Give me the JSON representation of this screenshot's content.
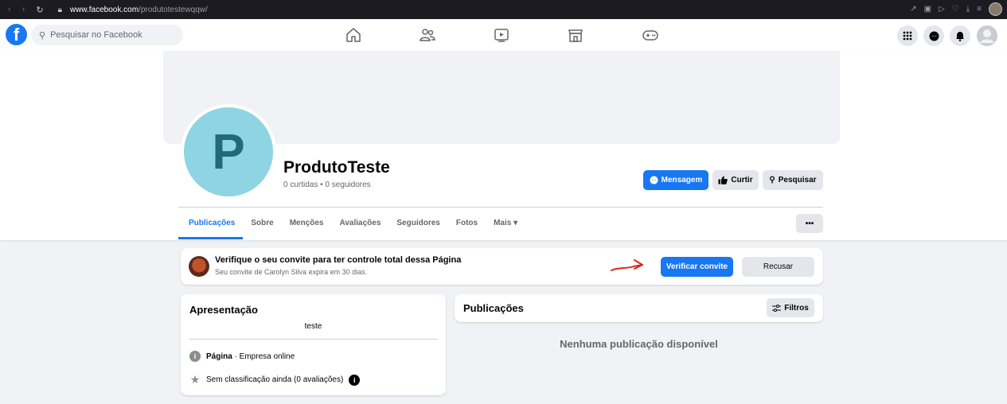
{
  "browser": {
    "url_domain": "www.facebook.com",
    "url_path": "/produtotestewqqw/"
  },
  "topnav": {
    "logo": "f",
    "search_placeholder": "Pesquisar no Facebook",
    "center_icons": [
      "home-icon",
      "friends-icon",
      "watch-icon",
      "marketplace-icon",
      "gaming-icon"
    ],
    "right_icons": [
      "menu-grid-icon",
      "messenger-icon",
      "notifications-icon",
      "account-avatar"
    ]
  },
  "profile": {
    "avatar_letter": "P",
    "name": "ProdutoTeste",
    "stats": "0 curtidas • 0 seguidores",
    "buttons": {
      "message": "Mensagem",
      "like": "Curtir",
      "search": "Pesquisar"
    },
    "tabs": [
      "Publicações",
      "Sobre",
      "Menções",
      "Avaliações",
      "Seguidores",
      "Fotos",
      "Mais ▾"
    ],
    "active_tab": "Publicações",
    "more_button": "•••"
  },
  "invite": {
    "title": "Verifique o seu convite para ter controle total dessa Página",
    "subtitle": "Seu convite de Carolyn Silva expira em 30 dias.",
    "verify_button": "Verificar convite",
    "decline_button": "Recusar",
    "annotation_color": "#d9291c"
  },
  "intro": {
    "title": "Apresentação",
    "bio": "teste",
    "page_type_bold": "Página",
    "page_type_rest": " · Empresa online",
    "rating": "Sem classificação ainda (0 avaliações)"
  },
  "posts": {
    "title": "Publicações",
    "filters_button": "Filtros",
    "empty_text": "Nenhuma publicação disponível"
  },
  "colors": {
    "accent": "#1877f2",
    "background": "#f0f2f5",
    "avatar_bg": "#8fd4e2",
    "avatar_letter": "#216a7c"
  }
}
